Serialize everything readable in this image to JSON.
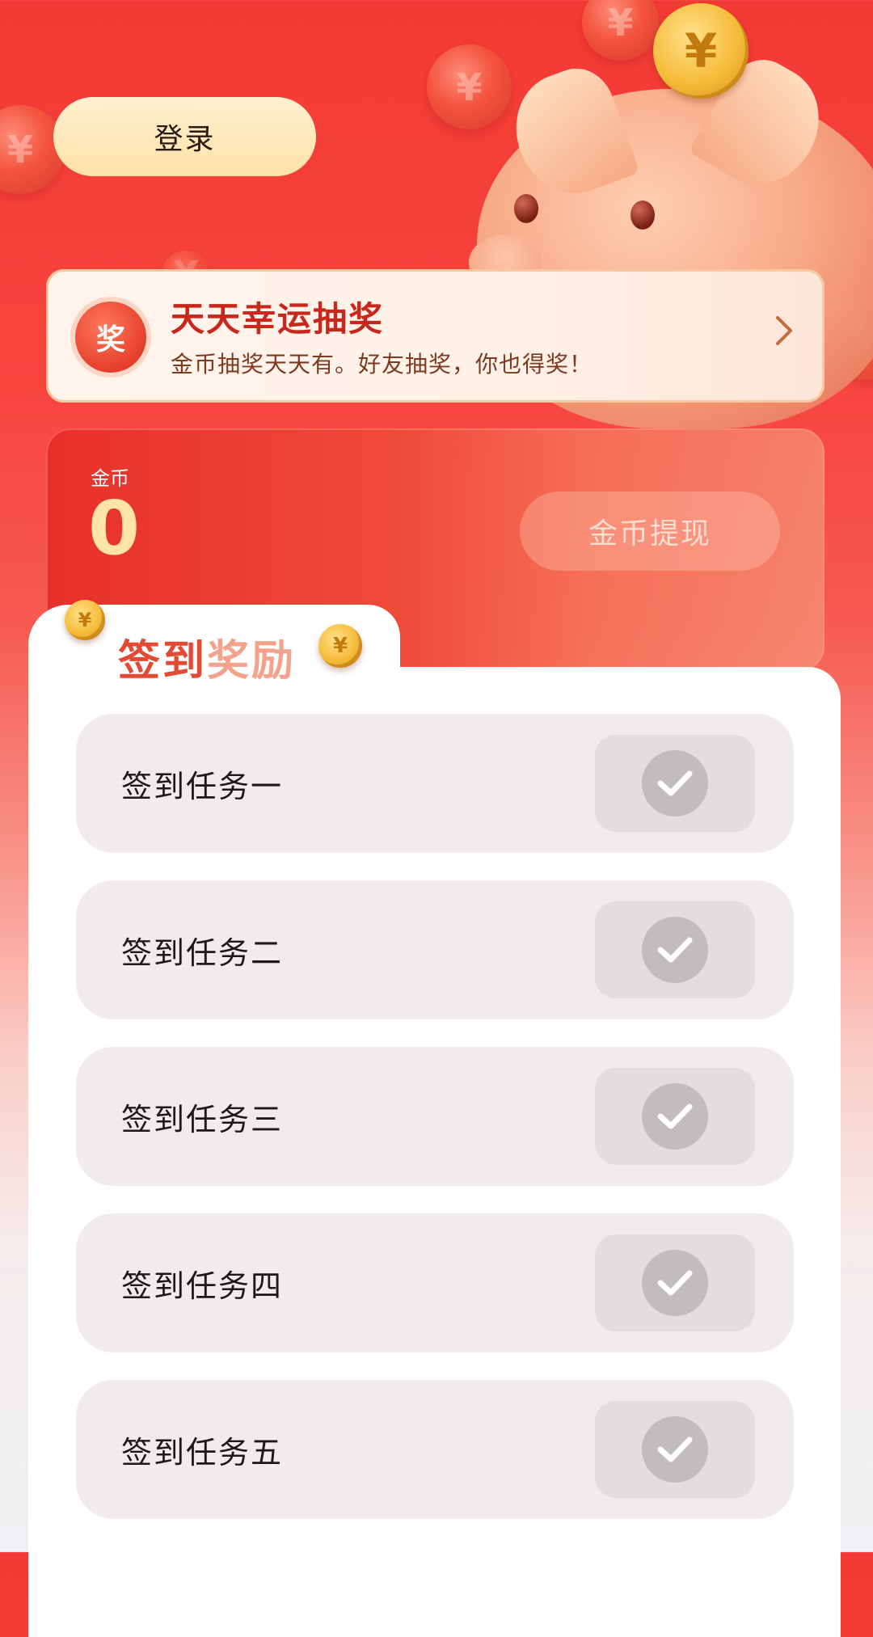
{
  "header": {
    "login_label": "登录"
  },
  "lottery": {
    "icon_text": "奖",
    "title": "天天幸运抽奖",
    "subtitle": "金币抽奖天天有。好友抽奖，你也得奖！",
    "chevron_icon": "chevron-right-icon"
  },
  "coins": {
    "label": "金币",
    "value": "0",
    "withdraw_label": "金币提现"
  },
  "signin": {
    "title_part1": "签到",
    "title_part2": "奖励",
    "tasks": [
      {
        "label": "签到任务一",
        "status_icon": "check-icon"
      },
      {
        "label": "签到任务二",
        "status_icon": "check-icon"
      },
      {
        "label": "签到任务三",
        "status_icon": "check-icon"
      },
      {
        "label": "签到任务四",
        "status_icon": "check-icon"
      },
      {
        "label": "签到任务五",
        "status_icon": "check-icon"
      }
    ]
  },
  "colors": {
    "primary_red": "#e24a33",
    "gold": "#ffe4a8",
    "login_bg": "#fde2a8",
    "task_bg": "#f1ebeb"
  }
}
